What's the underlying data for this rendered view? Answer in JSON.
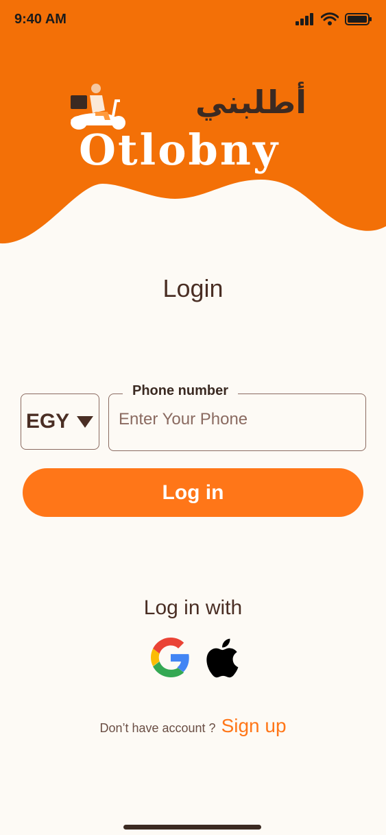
{
  "status_bar": {
    "time": "9:40 AM"
  },
  "brand": {
    "arabic_name": "أطلبني",
    "latin_name": "Otlobny"
  },
  "page": {
    "title": "Login"
  },
  "form": {
    "country_code": "EGY",
    "phone_label": "Phone number",
    "phone_placeholder": "Enter Your Phone",
    "login_button": "Log in"
  },
  "social": {
    "heading": "Log in with",
    "providers": [
      "google-icon",
      "apple-icon"
    ]
  },
  "signup": {
    "question": "Don’t have account ?",
    "link": "Sign up"
  },
  "colors": {
    "accent": "#ff7618",
    "header": "#f37007",
    "text": "#4a2e24",
    "background": "#fdfaf5"
  }
}
